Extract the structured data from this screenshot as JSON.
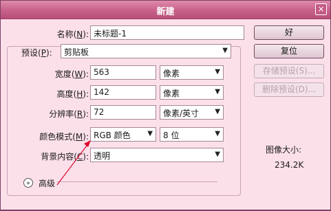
{
  "dialog": {
    "title": "新建",
    "close_glyph": "×"
  },
  "name": {
    "label_pre": "名称(",
    "label_key": "N",
    "label_post": "):",
    "value": "未标题-1"
  },
  "preset": {
    "label_pre": "预设(",
    "label_key": "P",
    "label_post": "):",
    "value": "剪贴板"
  },
  "width": {
    "label_pre": "宽度(",
    "label_key": "W",
    "label_post": "):",
    "value": "563",
    "unit": "像素"
  },
  "height": {
    "label_pre": "高度(",
    "label_key": "H",
    "label_post": "):",
    "value": "142",
    "unit": "像素"
  },
  "resolution": {
    "label_pre": "分辨率(",
    "label_key": "R",
    "label_post": "):",
    "value": "72",
    "unit": "像素/英寸"
  },
  "color_mode": {
    "label_pre": "颜色模式(",
    "label_key": "M",
    "label_post": "):",
    "value": "RGB 颜色",
    "depth": "8 位"
  },
  "background": {
    "label_pre": "背景内容(",
    "label_key": "C",
    "label_post": "):",
    "value": "透明"
  },
  "advanced": {
    "label": "高级",
    "icon": "double-chevron-down-icon"
  },
  "buttons": {
    "ok": "好",
    "reset": "复位",
    "save_preset": "存储预设(S)...",
    "delete_preset": "删除预设(D)..."
  },
  "image_size": {
    "label": "图像大小:",
    "value": "234.2K"
  },
  "annotation_color": "#e0002a"
}
